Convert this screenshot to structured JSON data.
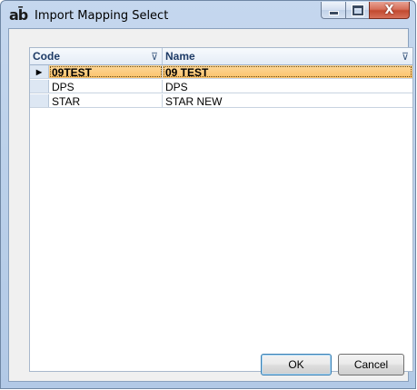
{
  "window": {
    "icon_text": "ab̄",
    "title": "Import Mapping Select",
    "close_glyph": "X"
  },
  "grid": {
    "columns": [
      {
        "label": "Code",
        "filter_icon": "⊽"
      },
      {
        "label": "Name",
        "filter_icon": "⊽"
      }
    ],
    "row_indicator": "▶",
    "rows": [
      {
        "code": "09TEST",
        "name": "09 TEST",
        "selected": true
      },
      {
        "code": "DPS",
        "name": "DPS",
        "selected": false
      },
      {
        "code": "STAR",
        "name": "STAR NEW",
        "selected": false
      }
    ]
  },
  "buttons": {
    "ok_label": "OK",
    "cancel_label": "Cancel"
  },
  "colors": {
    "selection": "#fbc26a",
    "header_text": "#1e3b66"
  }
}
